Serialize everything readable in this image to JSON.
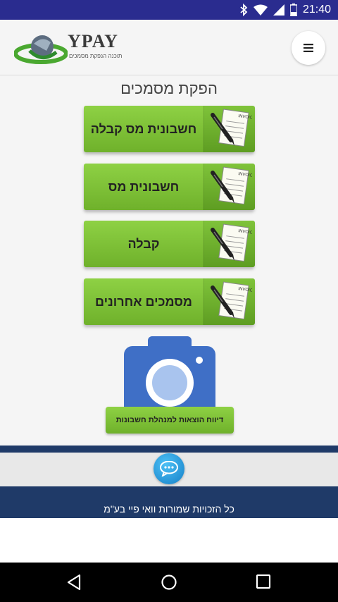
{
  "status_bar": {
    "time": "21:40",
    "icons": [
      "bluetooth-icon",
      "wifi-icon",
      "signal-icon",
      "battery-icon"
    ]
  },
  "header": {
    "logo_text": "YPAY",
    "logo_tagline": "תוכנה הנפקת מסמכים",
    "menu_icon": "hamburger-icon"
  },
  "main": {
    "title": "הפקת מסמכים",
    "buttons": [
      {
        "label": "חשבונית מס קבלה",
        "icon": "invoice-pen-icon"
      },
      {
        "label": "חשבונית מס",
        "icon": "invoice-pen-icon"
      },
      {
        "label": "קבלה",
        "icon": "invoice-pen-icon"
      },
      {
        "label": "מסמכים אחרונים",
        "icon": "invoice-pen-icon"
      }
    ],
    "icon_paper_text": "INVOICE",
    "camera_icon": "camera-icon",
    "expense_report_label": "דיווח הוצאות למנהלת חשבונות"
  },
  "footer": {
    "chat_icon": "chat-bubble-icon",
    "copyright": "כל הזכויות שמורות וואי פיי בע\"מ"
  },
  "colors": {
    "status_bar": "#2a2c8f",
    "accent_green": "#7cc03a",
    "footer_navy": "#1f3a68",
    "camera_blue": "#3f6fc6"
  }
}
